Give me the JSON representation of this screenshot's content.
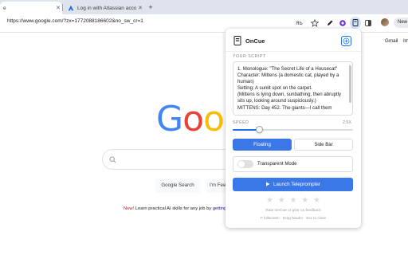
{
  "browser": {
    "tabs": [
      {
        "label": "e",
        "active": true
      },
      {
        "label": "Log in with Atlassian account",
        "active": false
      }
    ],
    "new_tab": "+",
    "url": "https://www.google.com/?zx=1772088186602&no_sw_cr=1",
    "new_button": "New"
  },
  "google": {
    "gmail": "Gmail",
    "images": "Im",
    "logo_letters": [
      "G",
      "o",
      "o",
      "g"
    ],
    "buttons": {
      "search": "Google Search",
      "lucky": "I'm Fee"
    },
    "promo": {
      "new": "New!",
      "text": " Learn practical AI skills for any job by ",
      "link": "getting"
    }
  },
  "popup": {
    "app_name": "OnCue",
    "script_label": "YOUR SCRIPT",
    "script_lines": [
      "1. Monologue: \"The Secret Life of a Housecat\"",
      "Character: Mittens (a domestic cat, played by a human)",
      "Setting: A sunlit spot on the carpet.",
      "(Mittens is lying down, sunbathing, then abruptly sits up, looking around suspiciously.)",
      "MITTENS: Day 452. The giants—I call them"
    ],
    "speed_label": "SPEED",
    "speed_max": "2.5X",
    "speed_value": 0.22,
    "modes": {
      "floating": "Floating",
      "sidebar": "Side Bar"
    },
    "transparent_mode": "Transparent Mode",
    "transparent_on": false,
    "launch": "Launch Teleprompter",
    "rating_stars": 5,
    "rate_text": "Rate OnCue or give us feedback",
    "hint": "F fullscreen · Drag header · Esc to close"
  },
  "colors": {
    "accent": "#3b78e7",
    "google_blue": "#4285F4",
    "google_red": "#EA4335",
    "google_yellow": "#FBBC05",
    "google_green": "#34A853"
  }
}
